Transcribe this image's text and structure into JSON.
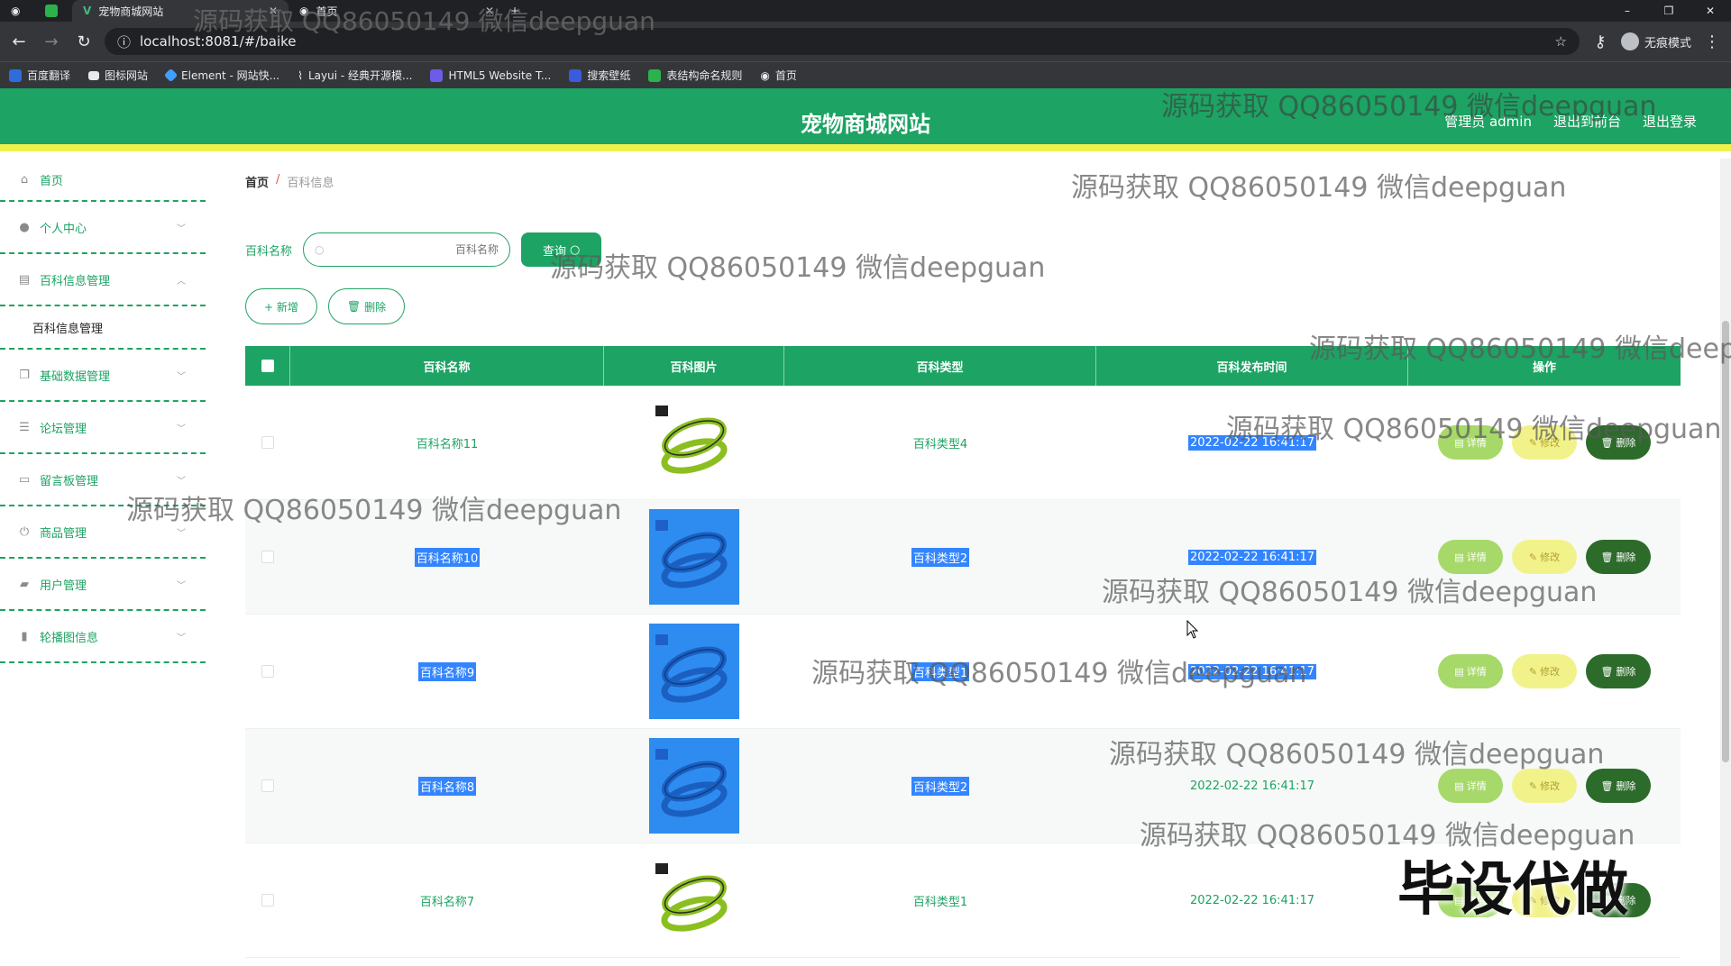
{
  "browser": {
    "tabs": [
      {
        "label": "宠物商城网站",
        "active": true
      },
      {
        "label": "首页",
        "active": false
      }
    ],
    "new_tab": "+",
    "url": "localhost:8081/#/baike",
    "profile_label": "无痕模式",
    "window_controls": [
      "–",
      "❐",
      "✕"
    ],
    "bookmarks": [
      {
        "label": "百度翻译",
        "color": "#2f6bd9"
      },
      {
        "label": "图标网站",
        "color": "#e8eaed"
      },
      {
        "label": "Element - 网站快...",
        "color": "#409eff"
      },
      {
        "label": "Layui - 经典开源模...",
        "color": "#e8eaed"
      },
      {
        "label": "HTML5 Website T...",
        "color": "#6c5ce7"
      },
      {
        "label": "搜索壁纸",
        "color": "#3b5bdb"
      },
      {
        "label": "表结构命名规则",
        "color": "#2bb24c"
      },
      {
        "label": "首页",
        "color": "#e8eaed"
      }
    ]
  },
  "header": {
    "title": "宠物商城网站",
    "links": [
      "管理员 admin",
      "退出到前台",
      "退出登录"
    ],
    "bg_color": "#1da363",
    "accent_color": "#f0f04a"
  },
  "sidebar": {
    "items": [
      {
        "label": "首页",
        "icon": "home-icon",
        "glyph": "⌂"
      },
      {
        "label": "个人中心",
        "icon": "user-icon",
        "glyph": "👤"
      },
      {
        "label": "百科信息管理",
        "icon": "book-icon",
        "glyph": "▤",
        "expanded": true,
        "children": [
          "百科信息管理"
        ]
      },
      {
        "label": "基础数据管理",
        "icon": "copy-icon",
        "glyph": "❐"
      },
      {
        "label": "论坛管理",
        "icon": "sliders-icon",
        "glyph": "☰"
      },
      {
        "label": "留言板管理",
        "icon": "chat-icon",
        "glyph": "▭"
      },
      {
        "label": "商品管理",
        "icon": "power-icon",
        "glyph": "⏻"
      },
      {
        "label": "用户管理",
        "icon": "briefcase-icon",
        "glyph": "▰"
      },
      {
        "label": "轮播图信息",
        "icon": "bar-chart-icon",
        "glyph": "▮"
      }
    ]
  },
  "breadcrumb": {
    "home": "首页",
    "sep": "/",
    "current": "百科信息"
  },
  "search": {
    "label": "百科名称",
    "placeholder": "百科名称",
    "button": "查询"
  },
  "actions": {
    "add": "+ 新增",
    "delete": "删除"
  },
  "table": {
    "columns": [
      "百科名称",
      "百科图片",
      "百科类型",
      "百科发布时间",
      "操作"
    ],
    "rows": [
      {
        "name": "百科名称11",
        "type": "百科类型4",
        "time": "2022-02-22 16:41:17",
        "image": "leash-photo",
        "highlight": false
      },
      {
        "name": "百科名称10",
        "type": "百科类型2",
        "time": "2022-02-22 16:41:17",
        "image": "leash-photo-selected",
        "highlight": true
      },
      {
        "name": "百科名称9",
        "type": "百科类型1",
        "time": "2022-02-22 16:41:17",
        "image": "leash-photo-selected",
        "highlight": true
      },
      {
        "name": "百科名称8",
        "type": "百科类型2",
        "time": "2022-02-22 16:41:17",
        "image": "leash-photo-selected",
        "highlight": true
      },
      {
        "name": "百科名称7",
        "type": "百科类型1",
        "time": "2022-02-22 16:41:17",
        "image": "leash-photo",
        "highlight": false
      }
    ],
    "row_actions": {
      "detail": "详情",
      "edit": "修改",
      "delete": "删除"
    }
  },
  "watermarks": {
    "text": "源码获取 QQ86050149 微信deepguan",
    "tab_text": "源码获取 QQ86050149 微信deepguan",
    "big": "毕设代做"
  }
}
